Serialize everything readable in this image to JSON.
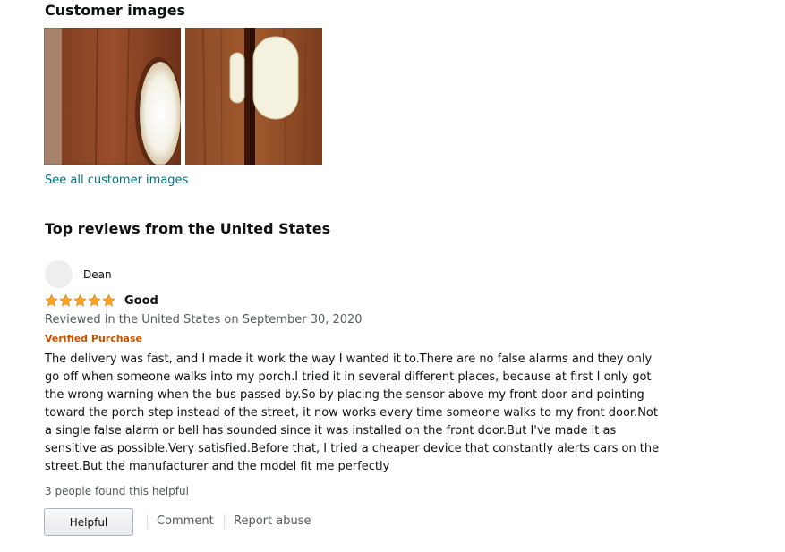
{
  "customer_images": {
    "title": "Customer images",
    "see_all_label": "See all customer images",
    "images": [
      {
        "icon": "door-window-photo"
      },
      {
        "icon": "door-sensor-photo"
      }
    ]
  },
  "reviews_section": {
    "title": "Top reviews from the United States"
  },
  "review": {
    "reviewer_name": "Dean",
    "rating": 5,
    "rating_max": 5,
    "title": "Good",
    "date": "Reviewed in the United States on September 30, 2020",
    "verified": "Verified Purchase",
    "body": "The delivery was fast, and I made it work the way I wanted it to.There are no false alarms and they only go off when someone walks into my porch.I tried it in several different places, because at first I only got the wrong warning when the bus passed by.So by placing the sensor above my front door and pointing toward the porch step instead of the street, it now works every time someone walks to my front door.Not a single false alarm or bell has sounded since it was installed on the front door.But I've made it as sensitive as possible.Very satisfied.Before that, I tried a cheaper device that constantly alerts cars on the street.But the manufacturer and the model fit me perfectly",
    "helpful_count_text": "3 people found this helpful",
    "helpful_button_label": "Helpful",
    "comment_label": "Comment",
    "report_label": "Report abuse"
  },
  "colors": {
    "link": "#007185",
    "star": "#ffa41c",
    "verified": "#c45500",
    "secondary_text": "#565959"
  }
}
